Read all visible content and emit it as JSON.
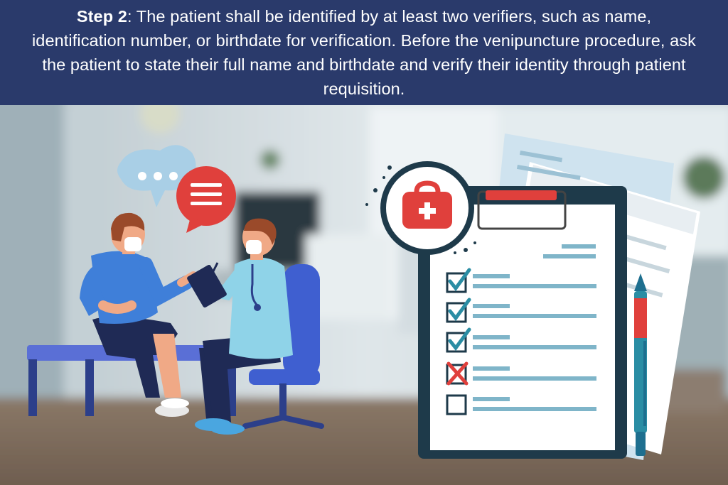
{
  "banner": {
    "step_label": "Step 2",
    "text": ": The patient shall be identified by at least two verifiers, such as name, identification number, or birthdate for verification. Before the venipuncture procedure, ask the patient to state their full name and birthdate and verify their identity through patient requisition."
  },
  "icons": [
    "speech-bubble-dots-icon",
    "speech-bubble-lines-icon",
    "medical-bag-icon",
    "clipboard-icon",
    "checkbox-checked-icon",
    "checkbox-crossed-icon",
    "checkbox-empty-icon",
    "pen-icon"
  ],
  "colors": {
    "banner": "#2a3a6b",
    "clipboard": "#1e3a4a",
    "accent_red": "#e0403c",
    "check_teal": "#2a8da4",
    "line_blue": "#7fb5c9"
  },
  "checklist": [
    {
      "state": "checked"
    },
    {
      "state": "checked"
    },
    {
      "state": "checked"
    },
    {
      "state": "crossed"
    },
    {
      "state": "empty"
    }
  ]
}
